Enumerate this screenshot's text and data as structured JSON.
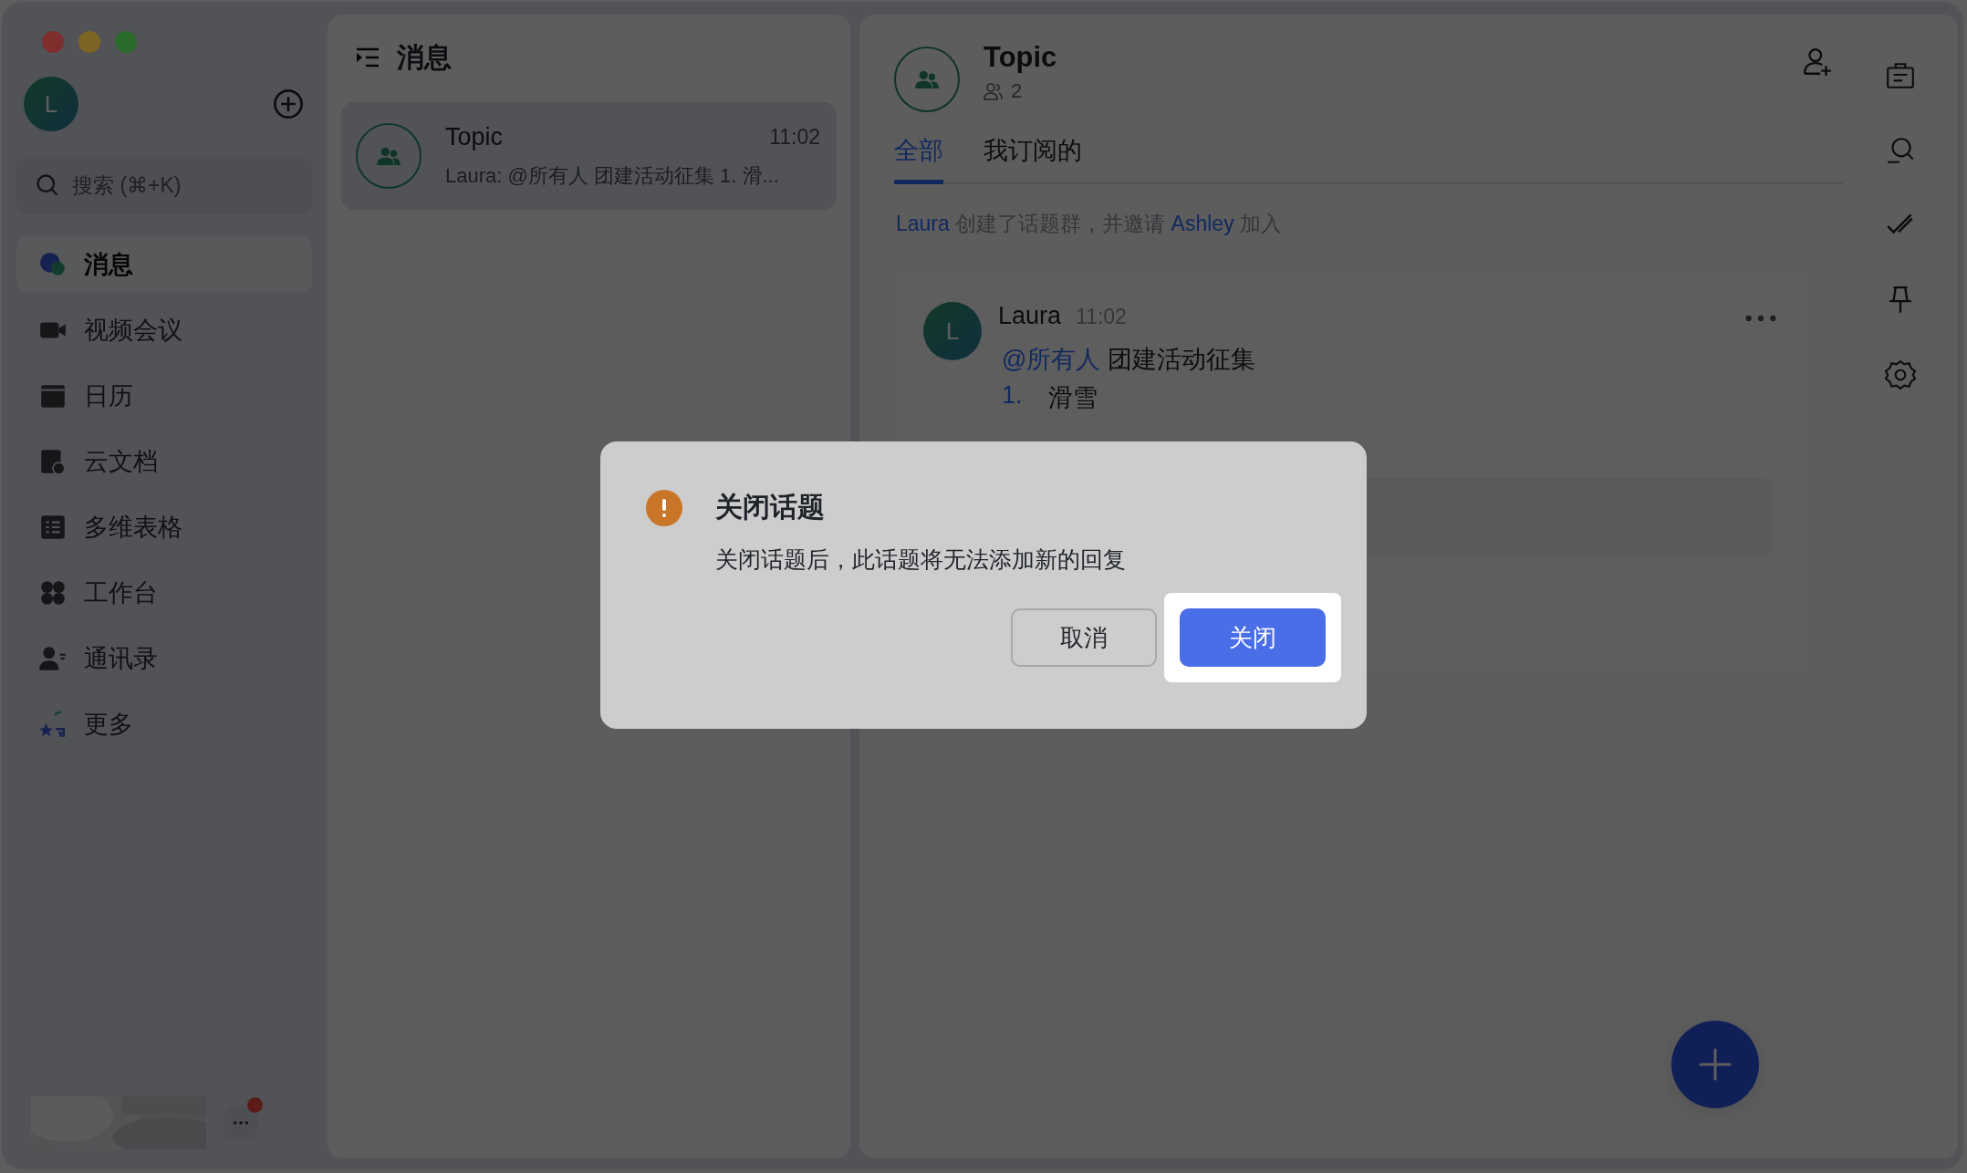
{
  "window_controls": [
    {
      "color": "#7e2e2c"
    },
    {
      "color": "#7d6424"
    },
    {
      "color": "#2a6a2a"
    }
  ],
  "sidebar": {
    "avatar": "L",
    "search": {
      "placeholder": "搜索 (⌘+K)"
    },
    "items": [
      {
        "label": "消息",
        "selected": true
      },
      {
        "label": "视频会议",
        "selected": false
      },
      {
        "label": "日历",
        "selected": false
      },
      {
        "label": "云文档",
        "selected": false
      },
      {
        "label": "多维表格",
        "selected": false
      },
      {
        "label": "工作台",
        "selected": false
      },
      {
        "label": "通讯录",
        "selected": false
      },
      {
        "label": "更多",
        "selected": false
      }
    ],
    "more_unread": true
  },
  "message_list": {
    "title": "消息",
    "conversations": [
      {
        "name": "Topic",
        "time": "11:02",
        "preview": "Laura: @所有人 团建活动征集 1. 滑...",
        "selected": true
      }
    ]
  },
  "chat": {
    "title": "Topic",
    "member_count": "2",
    "tabs": [
      {
        "label": "全部",
        "selected": true
      },
      {
        "label": "我订阅的",
        "selected": false
      }
    ],
    "system_message": {
      "actor": "Laura",
      "text": "创建了话题群，并邀请",
      "invitee": "Ashley",
      "tail": "加入"
    },
    "message": {
      "avatar": "L",
      "author": "Laura",
      "time": "11:02",
      "mention": "@所有人",
      "text": "团建活动征集",
      "list": [
        {
          "number": "1.",
          "text": "滑雪"
        }
      ]
    }
  },
  "dialog": {
    "title": "关闭话题",
    "body": "关闭话题后，此话题将无法添加新的回复",
    "buttons": [
      {
        "label": "取消",
        "kind": "secondary",
        "highlighted": false
      },
      {
        "label": "关闭",
        "kind": "primary",
        "highlighted": true
      }
    ]
  }
}
